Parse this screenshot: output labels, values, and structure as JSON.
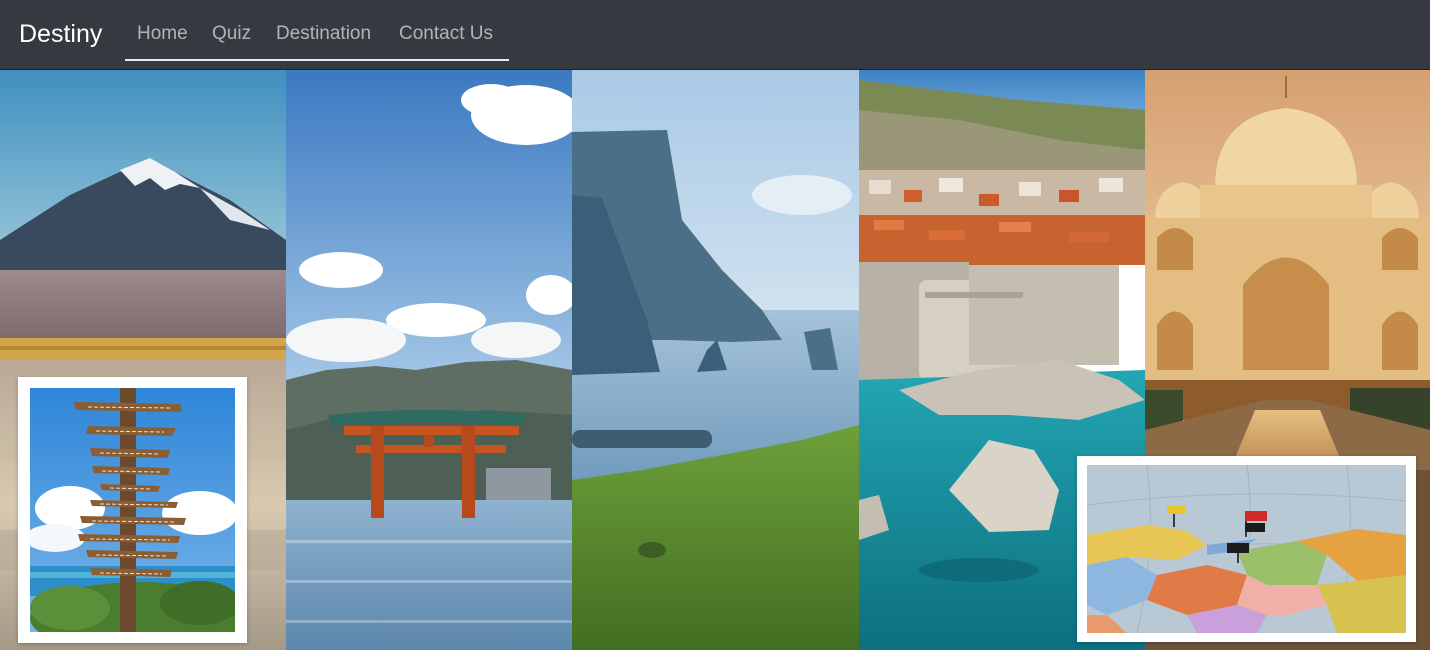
{
  "navbar": {
    "brand": "Destiny",
    "links": [
      {
        "label": "Home"
      },
      {
        "label": "Quiz"
      },
      {
        "label": "Destination"
      },
      {
        "label": "Contact Us"
      }
    ]
  },
  "hero": {
    "panels": [
      {
        "name": "snowy-volcano-desert"
      },
      {
        "name": "torii-gate-in-sea"
      },
      {
        "name": "sea-cliffs-green-hill"
      },
      {
        "name": "coastal-fortress-town"
      },
      {
        "name": "domed-palace"
      }
    ],
    "insets": [
      {
        "name": "signpost-on-beach"
      },
      {
        "name": "world-map-with-pins"
      }
    ]
  },
  "colors": {
    "navbar_bg": "#343a40",
    "brand_text": "#ffffff",
    "nav_link": "#a8abae"
  }
}
